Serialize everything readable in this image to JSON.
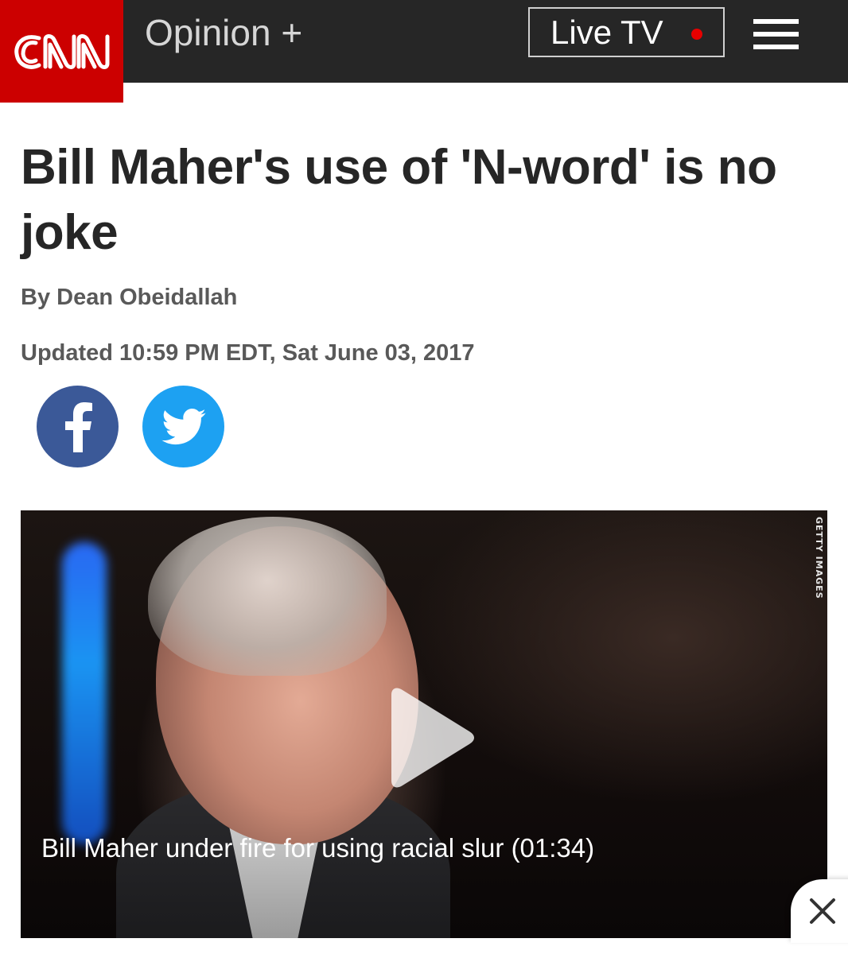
{
  "header": {
    "logo_text": "CNN",
    "section_label": "Opinion +",
    "live_label": "Live TV",
    "logo_bg": "#cc0000",
    "bar_bg": "#262626",
    "live_dot_color": "#e60000"
  },
  "article": {
    "headline": "Bill Maher's use of 'N-word' is no joke",
    "byline": "By Dean Obeidallah",
    "updated": "Updated 10:59 PM EDT, Sat June 03, 2017"
  },
  "share": {
    "facebook_icon": "facebook-icon",
    "twitter_icon": "twitter-icon",
    "facebook_color": "#3b5998",
    "twitter_color": "#1da1f2"
  },
  "video": {
    "caption": "Bill Maher under fire for using racial slur (01:34)",
    "credit": "GETTY IMAGES",
    "play_icon": "play-icon"
  },
  "overlay": {
    "close_icon": "close-icon"
  }
}
